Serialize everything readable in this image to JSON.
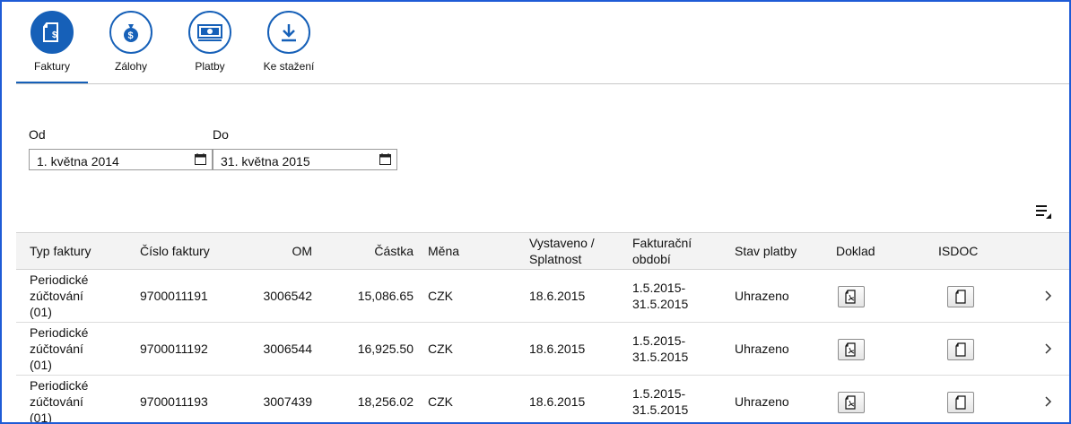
{
  "tabs": [
    {
      "label": "Faktury",
      "icon": "invoice-icon",
      "active": true
    },
    {
      "label": "Zálohy",
      "icon": "money-bag-icon",
      "active": false
    },
    {
      "label": "Platby",
      "icon": "banknote-icon",
      "active": false
    },
    {
      "label": "Ke stažení",
      "icon": "download-icon",
      "active": false
    }
  ],
  "filters": {
    "from_label": "Od",
    "from_value": "1. května 2014",
    "to_label": "Do",
    "to_value": "31. května 2015"
  },
  "table": {
    "headers": {
      "type": "Typ faktury",
      "number": "Číslo faktury",
      "om": "OM",
      "amount": "Částka",
      "currency": "Měna",
      "issued_line1": "Vystaveno /",
      "issued_line2": "Splatnost",
      "period_line1": "Fakturační",
      "period_line2": "období",
      "status": "Stav platby",
      "document": "Doklad",
      "isdoc": "ISDOC"
    },
    "rows": [
      {
        "type1": "Periodické",
        "type2": "zúčtování",
        "type3": "(01)",
        "number": "9700011191",
        "om": "3006542",
        "amount": "15,086.65",
        "currency": "CZK",
        "issued": "18.6.2015",
        "period1": "1.5.2015-",
        "period2": "31.5.2015",
        "status": "Uhrazeno"
      },
      {
        "type1": "Periodické",
        "type2": "zúčtování",
        "type3": "(01)",
        "number": "9700011192",
        "om": "3006544",
        "amount": "16,925.50",
        "currency": "CZK",
        "issued": "18.6.2015",
        "period1": "1.5.2015-",
        "period2": "31.5.2015",
        "status": "Uhrazeno"
      },
      {
        "type1": "Periodické",
        "type2": "zúčtování",
        "type3": "(01)",
        "number": "9700011193",
        "om": "3007439",
        "amount": "18,256.02",
        "currency": "CZK",
        "issued": "18.6.2015",
        "period1": "1.5.2015-",
        "period2": "31.5.2015",
        "status": "Uhrazeno"
      }
    ]
  },
  "colors": {
    "accent": "#1660b8",
    "frame": "#1e5bd6"
  }
}
